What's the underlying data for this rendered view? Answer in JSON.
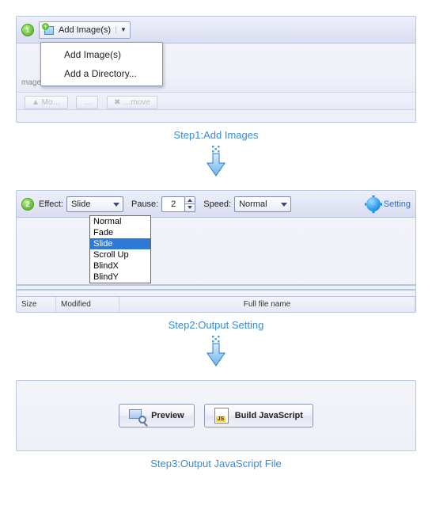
{
  "step1": {
    "badge": "1",
    "button_label": "Add Image(s)",
    "menu": [
      "Add Image(s)",
      "Add a Directory..."
    ],
    "faded_left": "mage",
    "faded_toolbar": [
      "▲ Mo…",
      "…",
      "✖ …move"
    ],
    "caption": "Step1:Add Images"
  },
  "step2": {
    "badge": "2",
    "labels": {
      "effect": "Effect:",
      "pause": "Pause:",
      "speed": "Speed:"
    },
    "effect_value": "Slide",
    "effect_options": [
      "Normal",
      "Fade",
      "Slide",
      "Scroll Up",
      "BlindX",
      "BlindY"
    ],
    "pause_value": "2",
    "speed_value": "Normal",
    "setting_label": "Setting",
    "columns": [
      "Size",
      "Modified",
      "Full file name"
    ],
    "caption": "Step2:Output Setting"
  },
  "step3": {
    "preview_label": "Preview",
    "build_label": "Build JavaScript",
    "caption": "Step3:Output JavaScript File"
  }
}
